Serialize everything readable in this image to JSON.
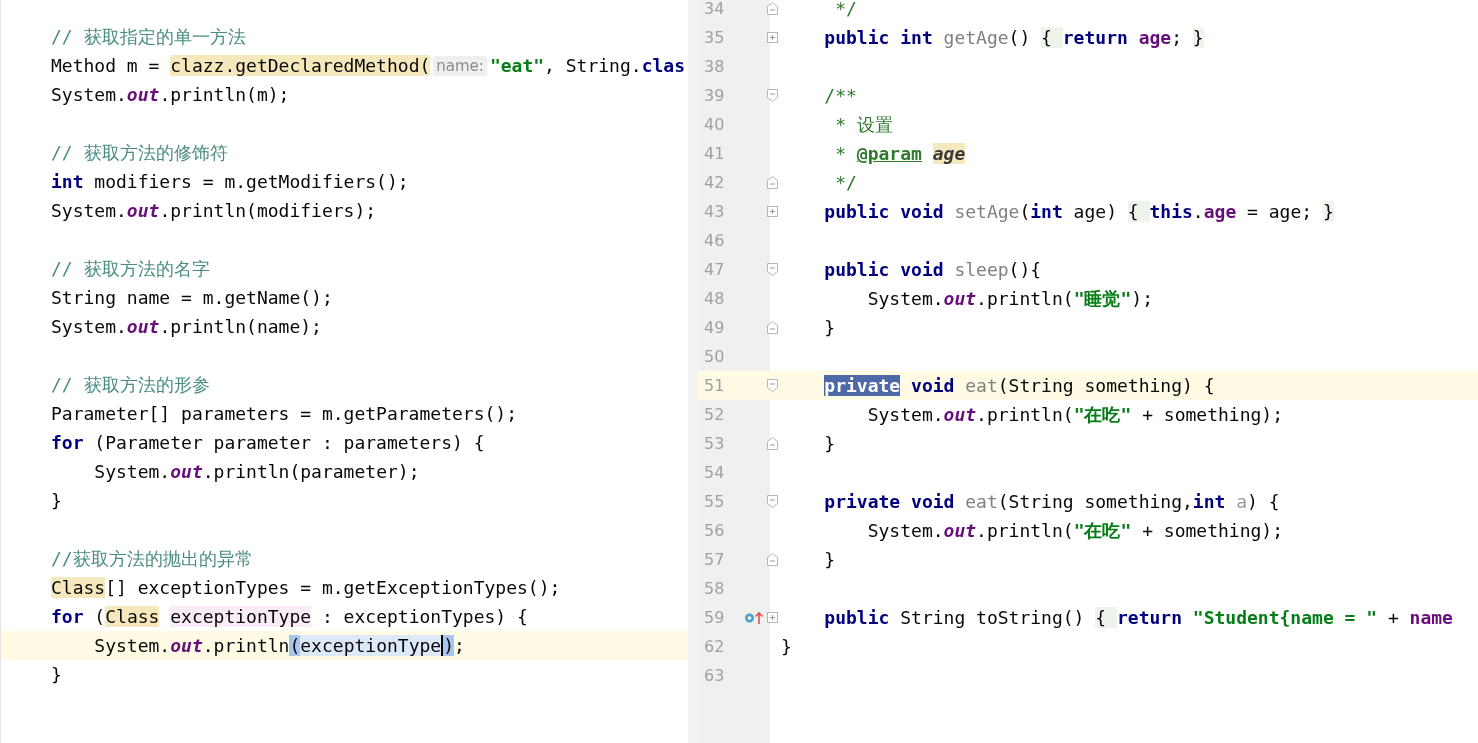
{
  "left_editor": {
    "blocks": [
      [
        {
          "current": false,
          "tokens": [
            {
              "text": "// 获取指定的单一方法",
              "kind": "comment"
            }
          ]
        },
        {
          "current": false,
          "tokens": [
            {
              "text": "Method m = ",
              "kind": "plain"
            },
            {
              "text": "clazz.getDeclaredMethod(",
              "kind": "usage"
            },
            {
              "text": "name:",
              "kind": "hint"
            },
            {
              "text": "\"eat\"",
              "kind": "string"
            },
            {
              "text": ", String.",
              "kind": "plain"
            },
            {
              "text": "clas",
              "kind": "keyword"
            }
          ]
        },
        {
          "current": false,
          "tokens": [
            {
              "text": "System.",
              "kind": "plain"
            },
            {
              "text": "out",
              "kind": "static"
            },
            {
              "text": ".println(m);",
              "kind": "plain"
            }
          ]
        }
      ],
      [
        {
          "current": false,
          "tokens": [
            {
              "text": "// 获取方法的修饰符",
              "kind": "comment"
            }
          ]
        },
        {
          "current": false,
          "tokens": [
            {
              "text": "int",
              "kind": "keyword"
            },
            {
              "text": " modifiers = m.getModifiers();",
              "kind": "plain"
            }
          ]
        },
        {
          "current": false,
          "tokens": [
            {
              "text": "System.",
              "kind": "plain"
            },
            {
              "text": "out",
              "kind": "static"
            },
            {
              "text": ".println(modifiers);",
              "kind": "plain"
            }
          ]
        }
      ],
      [
        {
          "current": false,
          "tokens": [
            {
              "text": "// 获取方法的名字",
              "kind": "comment"
            }
          ]
        },
        {
          "current": false,
          "tokens": [
            {
              "text": "String name = m.getName();",
              "kind": "plain"
            }
          ]
        },
        {
          "current": false,
          "tokens": [
            {
              "text": "System.",
              "kind": "plain"
            },
            {
              "text": "out",
              "kind": "static"
            },
            {
              "text": ".println(name);",
              "kind": "plain"
            }
          ]
        }
      ],
      [
        {
          "current": false,
          "tokens": [
            {
              "text": "// 获取方法的形参",
              "kind": "comment"
            }
          ]
        },
        {
          "current": false,
          "tokens": [
            {
              "text": "Parameter[] parameters = m.getParameters();",
              "kind": "plain"
            }
          ]
        },
        {
          "current": false,
          "tokens": [
            {
              "text": "for",
              "kind": "keyword"
            },
            {
              "text": " (Parameter parameter : parameters) {",
              "kind": "plain"
            }
          ]
        },
        {
          "current": false,
          "tokens": [
            {
              "text": "    System.",
              "kind": "plain"
            },
            {
              "text": "out",
              "kind": "static"
            },
            {
              "text": ".println(parameter);",
              "kind": "plain"
            }
          ]
        },
        {
          "current": false,
          "tokens": [
            {
              "text": "}",
              "kind": "plain"
            }
          ]
        }
      ],
      [
        {
          "current": false,
          "tokens": [
            {
              "text": "//获取方法的抛出的异常",
              "kind": "comment"
            }
          ]
        },
        {
          "current": false,
          "tokens": [
            {
              "text": "Class",
              "kind": "usage"
            },
            {
              "text": "[] exceptionTypes = m.getExceptionTypes();",
              "kind": "plain"
            }
          ]
        },
        {
          "current": false,
          "tokens": [
            {
              "text": "for",
              "kind": "keyword"
            },
            {
              "text": " (",
              "kind": "plain"
            },
            {
              "text": "Class",
              "kind": "usage"
            },
            {
              "text": " exceptionType",
              "kind": "write"
            },
            {
              "text": " : exceptionTypes) {",
              "kind": "plain"
            }
          ]
        },
        {
          "current": true,
          "tokens": [
            {
              "text": "    System.",
              "kind": "plain"
            },
            {
              "text": "out",
              "kind": "static"
            },
            {
              "text": ".println",
              "kind": "plain"
            },
            {
              "text": "(",
              "kind": "brace"
            },
            {
              "text": "exceptionType",
              "kind": "reference",
              "caret_after": true
            },
            {
              "text": ")",
              "kind": "brace"
            },
            {
              "text": ";",
              "kind": "plain"
            }
          ]
        },
        {
          "current": false,
          "tokens": [
            {
              "text": "}",
              "kind": "plain"
            }
          ]
        }
      ]
    ]
  },
  "right_editor": {
    "lines": [
      {
        "number": "34",
        "fold": {
          "kind": "end"
        },
        "current": false,
        "tokens": [
          {
            "text": "     */",
            "kind": "doc"
          }
        ]
      },
      {
        "number": "35",
        "fold": {
          "kind": "collapsed"
        },
        "current": false,
        "tokens": [
          {
            "text": "    public int",
            "kind": "keyword"
          },
          {
            "text": " getAge",
            "kind": "declaration"
          },
          {
            "text": "() ",
            "kind": "plain"
          },
          {
            "text": "{ ",
            "kind": "folded"
          },
          {
            "text": "return",
            "kind": "keyword"
          },
          {
            "text": " age",
            "kind": "member"
          },
          {
            "text": "; ",
            "kind": "plain"
          },
          {
            "text": "}",
            "kind": "folded"
          }
        ]
      },
      {
        "number": "38",
        "current": false
      },
      {
        "number": "39",
        "fold": {
          "kind": "start"
        },
        "current": false,
        "tokens": [
          {
            "text": "    /**",
            "kind": "doc"
          }
        ]
      },
      {
        "number": "40",
        "current": false,
        "tokens": [
          {
            "text": "     * 设置",
            "kind": "doc"
          }
        ]
      },
      {
        "number": "41",
        "current": false,
        "tokens": [
          {
            "text": "     * ",
            "kind": "doc"
          },
          {
            "text": "@param",
            "kind": "tag"
          },
          {
            "text": " age",
            "kind": "tag-value"
          }
        ]
      },
      {
        "number": "42",
        "fold": {
          "kind": "end"
        },
        "current": false,
        "tokens": [
          {
            "text": "     */",
            "kind": "doc"
          }
        ]
      },
      {
        "number": "43",
        "fold": {
          "kind": "collapsed"
        },
        "current": false,
        "tokens": [
          {
            "text": "    public void",
            "kind": "keyword"
          },
          {
            "text": " setAge",
            "kind": "declaration"
          },
          {
            "text": "(",
            "kind": "plain"
          },
          {
            "text": "int",
            "kind": "keyword"
          },
          {
            "text": " age) ",
            "kind": "plain"
          },
          {
            "text": "{ ",
            "kind": "folded"
          },
          {
            "text": "this",
            "kind": "keyword"
          },
          {
            "text": ".",
            "kind": "plain"
          },
          {
            "text": "age",
            "kind": "member"
          },
          {
            "text": " = age; ",
            "kind": "plain"
          },
          {
            "text": "}",
            "kind": "folded"
          }
        ]
      },
      {
        "number": "46",
        "current": false
      },
      {
        "number": "47",
        "fold": {
          "kind": "start"
        },
        "current": false,
        "tokens": [
          {
            "text": "    public void",
            "kind": "keyword"
          },
          {
            "text": " sleep",
            "kind": "declaration"
          },
          {
            "text": "(){",
            "kind": "plain"
          }
        ]
      },
      {
        "number": "48",
        "current": false,
        "tokens": [
          {
            "text": "        System.",
            "kind": "plain"
          },
          {
            "text": "out",
            "kind": "static"
          },
          {
            "text": ".println(",
            "kind": "plain"
          },
          {
            "text": "\"睡觉\"",
            "kind": "string"
          },
          {
            "text": ");",
            "kind": "plain"
          }
        ]
      },
      {
        "number": "49",
        "fold": {
          "kind": "end"
        },
        "current": false,
        "tokens": [
          {
            "text": "    }",
            "kind": "plain"
          }
        ]
      },
      {
        "number": "50",
        "current": false
      },
      {
        "number": "51",
        "fold": {
          "kind": "start"
        },
        "current": true,
        "tokens": [
          {
            "text": "    private",
            "kind": "selection"
          },
          {
            "text": " void",
            "kind": "keyword"
          },
          {
            "text": " eat",
            "kind": "declaration"
          },
          {
            "text": "(String something) {",
            "kind": "plain"
          }
        ]
      },
      {
        "number": "52",
        "current": false,
        "tokens": [
          {
            "text": "        System.",
            "kind": "plain"
          },
          {
            "text": "out",
            "kind": "static"
          },
          {
            "text": ".println(",
            "kind": "plain"
          },
          {
            "text": "\"在吃\"",
            "kind": "string"
          },
          {
            "text": " + something);",
            "kind": "plain"
          }
        ]
      },
      {
        "number": "53",
        "fold": {
          "kind": "end"
        },
        "current": false,
        "tokens": [
          {
            "text": "    }",
            "kind": "plain"
          }
        ]
      },
      {
        "number": "54",
        "current": false
      },
      {
        "number": "55",
        "fold": {
          "kind": "start"
        },
        "current": false,
        "tokens": [
          {
            "text": "    private void",
            "kind": "keyword"
          },
          {
            "text": " eat",
            "kind": "declaration"
          },
          {
            "text": "(String something,",
            "kind": "plain"
          },
          {
            "text": "int",
            "kind": "keyword"
          },
          {
            "text": " a",
            "kind": "unused"
          },
          {
            "text": ") {",
            "kind": "plain"
          }
        ]
      },
      {
        "number": "56",
        "current": false,
        "tokens": [
          {
            "text": "        System.",
            "kind": "plain"
          },
          {
            "text": "out",
            "kind": "static"
          },
          {
            "text": ".println(",
            "kind": "plain"
          },
          {
            "text": "\"在吃\"",
            "kind": "string"
          },
          {
            "text": " + something);",
            "kind": "plain"
          }
        ]
      },
      {
        "number": "57",
        "fold": {
          "kind": "end"
        },
        "current": false,
        "tokens": [
          {
            "text": "    }",
            "kind": "plain"
          }
        ]
      },
      {
        "number": "58",
        "current": false
      },
      {
        "number": "59",
        "fold": {
          "kind": "collapsed"
        },
        "marker": {
          "kind": "override"
        },
        "current": false,
        "tokens": [
          {
            "text": "    public",
            "kind": "keyword"
          },
          {
            "text": " String toString() ",
            "kind": "plain"
          },
          {
            "text": "{ ",
            "kind": "folded"
          },
          {
            "text": "return",
            "kind": "keyword"
          },
          {
            "text": " \"Student{name = \"",
            "kind": "string"
          },
          {
            "text": " + ",
            "kind": "plain"
          },
          {
            "text": "name",
            "kind": "member"
          }
        ]
      },
      {
        "number": "62",
        "current": false,
        "tokens": [
          {
            "text": "}",
            "kind": "plain"
          }
        ]
      },
      {
        "number": "63",
        "current": false
      }
    ]
  }
}
